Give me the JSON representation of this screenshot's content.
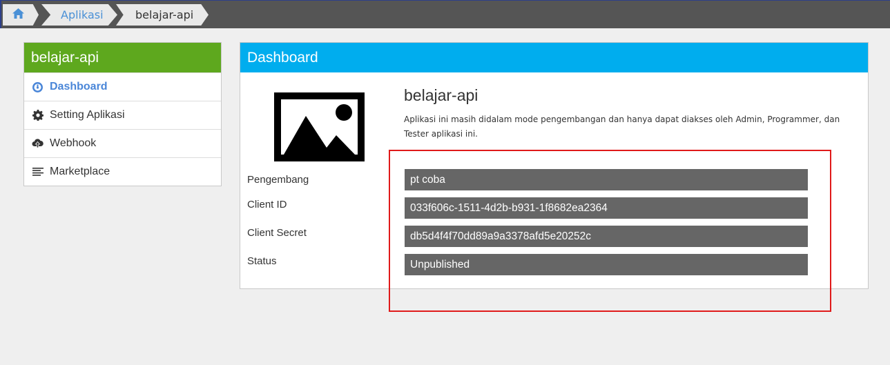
{
  "breadcrumb": {
    "home_icon": "home-icon",
    "items": [
      "Aplikasi",
      "belajar-api"
    ]
  },
  "sidebar": {
    "title": "belajar-api",
    "items": [
      {
        "label": "Dashboard",
        "icon": "dashboard-icon",
        "active": true
      },
      {
        "label": "Setting Aplikasi",
        "icon": "gear-icon",
        "active": false
      },
      {
        "label": "Webhook",
        "icon": "cloud-upload-icon",
        "active": false
      },
      {
        "label": "Marketplace",
        "icon": "list-icon",
        "active": false
      }
    ]
  },
  "main": {
    "panel_title": "Dashboard",
    "app_name": "belajar-api",
    "app_description": "Aplikasi ini masih didalam mode pengembangan dan hanya dapat diakses oleh Admin, Programmer, dan Tester aplikasi ini.",
    "image_icon": "image-placeholder-icon",
    "fields": [
      {
        "label": "Pengembang",
        "value": "pt coba"
      },
      {
        "label": "Client ID",
        "value": "033f606c-1511-4d2b-b931-1f8682ea2364"
      },
      {
        "label": "Client Secret",
        "value": "db5d4f4f70dd89a9a3378afd5e20252c"
      },
      {
        "label": "Status",
        "value": "Unpublished"
      }
    ]
  },
  "colors": {
    "topbar": "#555555",
    "sidebar_header": "#5ea81e",
    "panel_header": "#00adee",
    "active_link": "#4a86d8",
    "field_bg": "#666666",
    "highlight": "#e01a1a"
  }
}
